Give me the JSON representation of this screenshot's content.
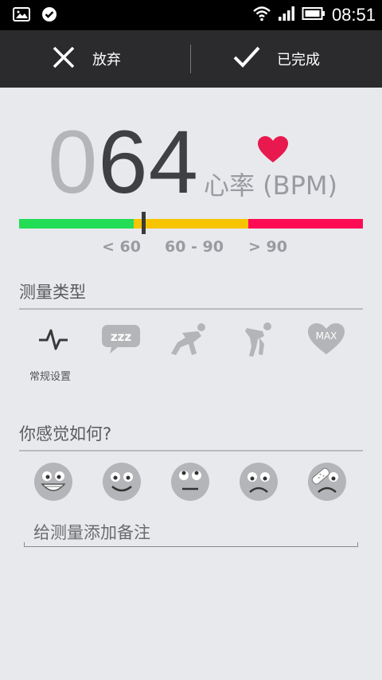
{
  "status_bar": {
    "time": "08:51",
    "icons": [
      "picture-icon",
      "check-circle-icon",
      "wifi-icon",
      "signal-icon",
      "battery-icon"
    ]
  },
  "action_bar": {
    "discard_label": "放弃",
    "done_label": "已完成"
  },
  "heart_rate": {
    "leading_zero": "0",
    "value": "64",
    "unit": "心率 (BPM)",
    "ranges": [
      {
        "label": "< 60",
        "color": "#22dd55"
      },
      {
        "label": "60 - 90",
        "color": "#f6c400"
      },
      {
        "label": "> 90",
        "color": "#ff0b55"
      }
    ],
    "heart_color": "#e8194e"
  },
  "measurement_type": {
    "title": "测量类型",
    "items": [
      {
        "icon": "pulse-icon",
        "caption": "常规设置",
        "selected": true
      },
      {
        "icon": "sleep-zzz-icon",
        "text": "zzz"
      },
      {
        "icon": "sprint-start-icon"
      },
      {
        "icon": "exhausted-runner-icon"
      },
      {
        "icon": "max-heart-icon",
        "text": "MAX"
      }
    ]
  },
  "feeling": {
    "title": "你感觉如何?",
    "moods": [
      "very-happy-face-icon",
      "happy-face-icon",
      "neutral-face-icon",
      "sad-face-icon",
      "injured-face-icon"
    ]
  },
  "note": {
    "placeholder": "给测量添加备注"
  }
}
